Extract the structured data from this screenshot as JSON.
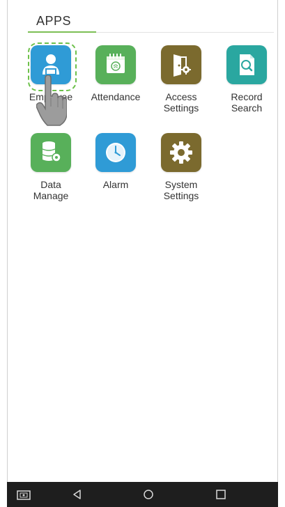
{
  "header": {
    "tab_label": "APPS"
  },
  "apps": [
    {
      "label": "Employee",
      "icon": "employee-icon",
      "color": "#2f9bd6"
    },
    {
      "label": "Attendance",
      "icon": "attendance-icon",
      "color": "#58b05a"
    },
    {
      "label": "Access\nSettings",
      "icon": "access-settings-icon",
      "color": "#7b6a2e"
    },
    {
      "label": "Record\nSearch",
      "icon": "record-search-icon",
      "color": "#2aa7a0"
    },
    {
      "label": "Data\nManage",
      "icon": "data-manage-icon",
      "color": "#58b05a"
    },
    {
      "label": "Alarm",
      "icon": "alarm-icon",
      "color": "#2f9bd6"
    },
    {
      "label": "System\nSettings",
      "icon": "system-settings-icon",
      "color": "#7b6a2e"
    }
  ],
  "navbar": {
    "buttons": [
      "screenshot-icon",
      "back-icon",
      "home-icon",
      "recents-icon"
    ]
  }
}
